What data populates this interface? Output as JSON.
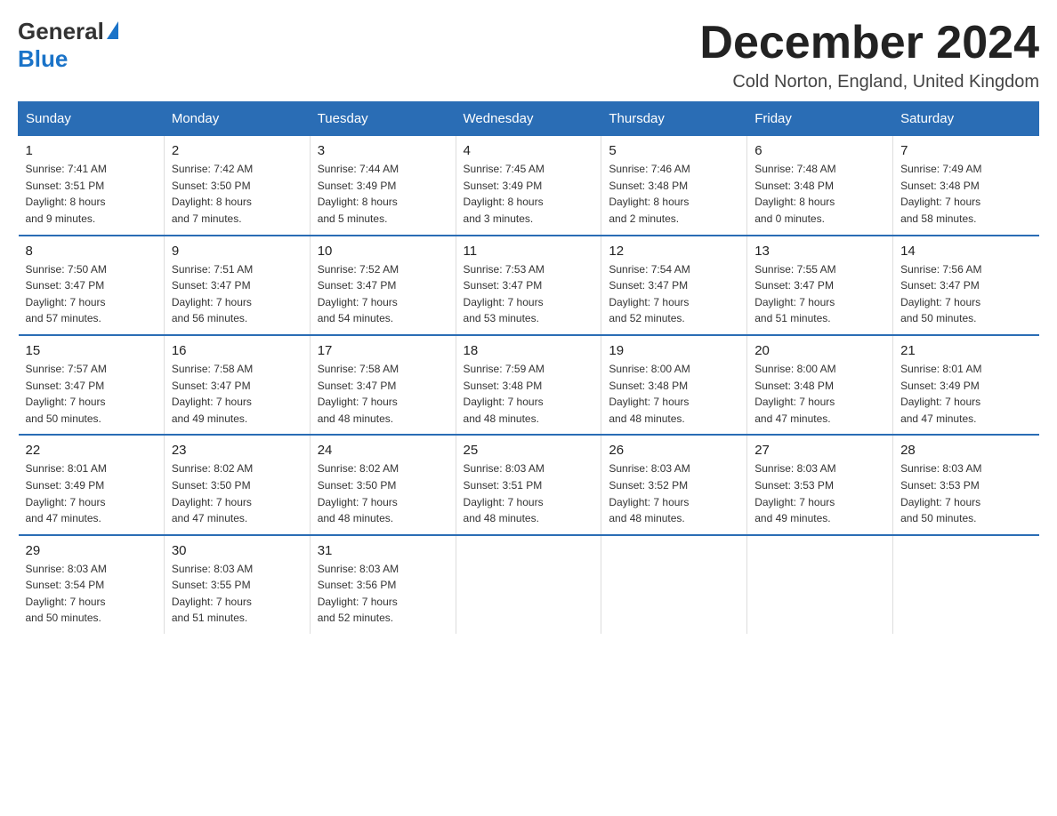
{
  "header": {
    "logo_line1": "General",
    "logo_triangle": "▶",
    "logo_line2": "Blue",
    "month_title": "December 2024",
    "subtitle": "Cold Norton, England, United Kingdom"
  },
  "days_of_week": [
    "Sunday",
    "Monday",
    "Tuesday",
    "Wednesday",
    "Thursday",
    "Friday",
    "Saturday"
  ],
  "weeks": [
    [
      {
        "day": "1",
        "info": "Sunrise: 7:41 AM\nSunset: 3:51 PM\nDaylight: 8 hours\nand 9 minutes."
      },
      {
        "day": "2",
        "info": "Sunrise: 7:42 AM\nSunset: 3:50 PM\nDaylight: 8 hours\nand 7 minutes."
      },
      {
        "day": "3",
        "info": "Sunrise: 7:44 AM\nSunset: 3:49 PM\nDaylight: 8 hours\nand 5 minutes."
      },
      {
        "day": "4",
        "info": "Sunrise: 7:45 AM\nSunset: 3:49 PM\nDaylight: 8 hours\nand 3 minutes."
      },
      {
        "day": "5",
        "info": "Sunrise: 7:46 AM\nSunset: 3:48 PM\nDaylight: 8 hours\nand 2 minutes."
      },
      {
        "day": "6",
        "info": "Sunrise: 7:48 AM\nSunset: 3:48 PM\nDaylight: 8 hours\nand 0 minutes."
      },
      {
        "day": "7",
        "info": "Sunrise: 7:49 AM\nSunset: 3:48 PM\nDaylight: 7 hours\nand 58 minutes."
      }
    ],
    [
      {
        "day": "8",
        "info": "Sunrise: 7:50 AM\nSunset: 3:47 PM\nDaylight: 7 hours\nand 57 minutes."
      },
      {
        "day": "9",
        "info": "Sunrise: 7:51 AM\nSunset: 3:47 PM\nDaylight: 7 hours\nand 56 minutes."
      },
      {
        "day": "10",
        "info": "Sunrise: 7:52 AM\nSunset: 3:47 PM\nDaylight: 7 hours\nand 54 minutes."
      },
      {
        "day": "11",
        "info": "Sunrise: 7:53 AM\nSunset: 3:47 PM\nDaylight: 7 hours\nand 53 minutes."
      },
      {
        "day": "12",
        "info": "Sunrise: 7:54 AM\nSunset: 3:47 PM\nDaylight: 7 hours\nand 52 minutes."
      },
      {
        "day": "13",
        "info": "Sunrise: 7:55 AM\nSunset: 3:47 PM\nDaylight: 7 hours\nand 51 minutes."
      },
      {
        "day": "14",
        "info": "Sunrise: 7:56 AM\nSunset: 3:47 PM\nDaylight: 7 hours\nand 50 minutes."
      }
    ],
    [
      {
        "day": "15",
        "info": "Sunrise: 7:57 AM\nSunset: 3:47 PM\nDaylight: 7 hours\nand 50 minutes."
      },
      {
        "day": "16",
        "info": "Sunrise: 7:58 AM\nSunset: 3:47 PM\nDaylight: 7 hours\nand 49 minutes."
      },
      {
        "day": "17",
        "info": "Sunrise: 7:58 AM\nSunset: 3:47 PM\nDaylight: 7 hours\nand 48 minutes."
      },
      {
        "day": "18",
        "info": "Sunrise: 7:59 AM\nSunset: 3:48 PM\nDaylight: 7 hours\nand 48 minutes."
      },
      {
        "day": "19",
        "info": "Sunrise: 8:00 AM\nSunset: 3:48 PM\nDaylight: 7 hours\nand 48 minutes."
      },
      {
        "day": "20",
        "info": "Sunrise: 8:00 AM\nSunset: 3:48 PM\nDaylight: 7 hours\nand 47 minutes."
      },
      {
        "day": "21",
        "info": "Sunrise: 8:01 AM\nSunset: 3:49 PM\nDaylight: 7 hours\nand 47 minutes."
      }
    ],
    [
      {
        "day": "22",
        "info": "Sunrise: 8:01 AM\nSunset: 3:49 PM\nDaylight: 7 hours\nand 47 minutes."
      },
      {
        "day": "23",
        "info": "Sunrise: 8:02 AM\nSunset: 3:50 PM\nDaylight: 7 hours\nand 47 minutes."
      },
      {
        "day": "24",
        "info": "Sunrise: 8:02 AM\nSunset: 3:50 PM\nDaylight: 7 hours\nand 48 minutes."
      },
      {
        "day": "25",
        "info": "Sunrise: 8:03 AM\nSunset: 3:51 PM\nDaylight: 7 hours\nand 48 minutes."
      },
      {
        "day": "26",
        "info": "Sunrise: 8:03 AM\nSunset: 3:52 PM\nDaylight: 7 hours\nand 48 minutes."
      },
      {
        "day": "27",
        "info": "Sunrise: 8:03 AM\nSunset: 3:53 PM\nDaylight: 7 hours\nand 49 minutes."
      },
      {
        "day": "28",
        "info": "Sunrise: 8:03 AM\nSunset: 3:53 PM\nDaylight: 7 hours\nand 50 minutes."
      }
    ],
    [
      {
        "day": "29",
        "info": "Sunrise: 8:03 AM\nSunset: 3:54 PM\nDaylight: 7 hours\nand 50 minutes."
      },
      {
        "day": "30",
        "info": "Sunrise: 8:03 AM\nSunset: 3:55 PM\nDaylight: 7 hours\nand 51 minutes."
      },
      {
        "day": "31",
        "info": "Sunrise: 8:03 AM\nSunset: 3:56 PM\nDaylight: 7 hours\nand 52 minutes."
      },
      {
        "day": "",
        "info": ""
      },
      {
        "day": "",
        "info": ""
      },
      {
        "day": "",
        "info": ""
      },
      {
        "day": "",
        "info": ""
      }
    ]
  ]
}
